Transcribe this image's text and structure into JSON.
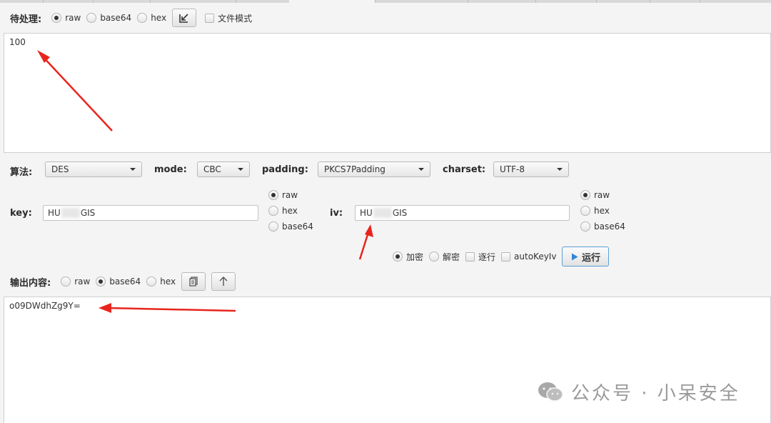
{
  "input_section": {
    "label": "待处理:",
    "formats": [
      "raw",
      "base64",
      "hex"
    ],
    "selected_format": "raw",
    "file_mode_label": "文件模式",
    "text": "100"
  },
  "algo_row": {
    "algo_label": "算法:",
    "algo_value": "DES",
    "mode_label": "mode:",
    "mode_value": "CBC",
    "padding_label": "padding:",
    "padding_value": "PKCS7Padding",
    "charset_label": "charset:",
    "charset_value": "UTF-8"
  },
  "key_section": {
    "key_label": "key:",
    "key_prefix": "HU",
    "key_suffix": "GIS",
    "key_formats": [
      "raw",
      "hex",
      "base64"
    ],
    "key_selected": "raw",
    "iv_label": "iv:",
    "iv_prefix": "HU",
    "iv_suffix": "GIS",
    "iv_formats": [
      "raw",
      "hex",
      "base64"
    ],
    "iv_selected": "raw"
  },
  "action_row": {
    "encrypt_label": "加密",
    "decrypt_label": "解密",
    "line_by_line_label": "逐行",
    "autokeyiv_label": "autoKeyIv",
    "run_label": "运行",
    "selected": "encrypt"
  },
  "output_section": {
    "label": "输出内容:",
    "formats": [
      "raw",
      "base64",
      "hex"
    ],
    "selected_format": "base64",
    "text": "o09DWdhZg9Y="
  },
  "watermark": {
    "text": "公众号 · 小呆安全"
  },
  "colors": {
    "arrow": "#e8251d",
    "run_button_border": "#5a9fd4",
    "run_icon": "#2f86d6"
  }
}
